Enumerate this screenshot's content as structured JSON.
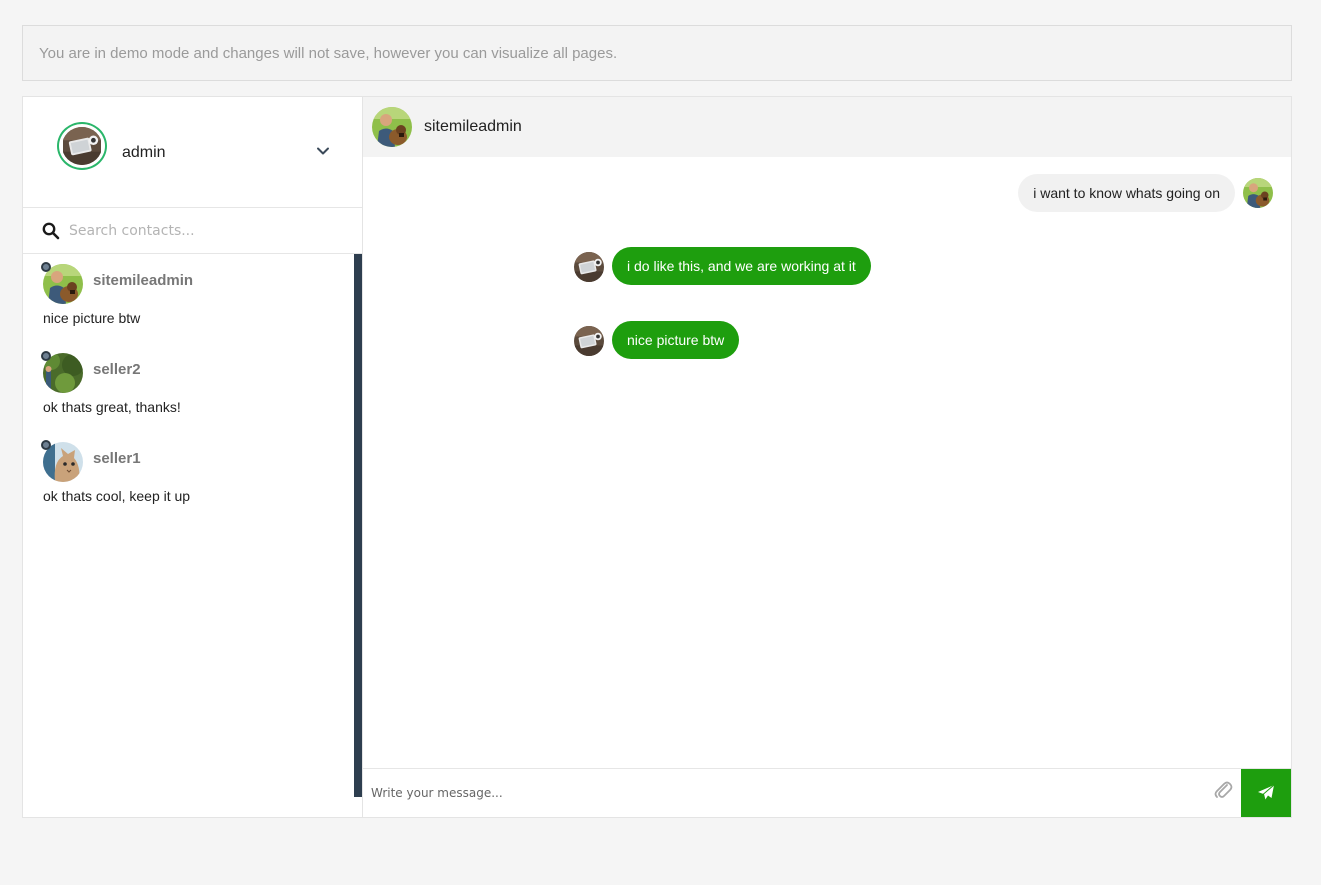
{
  "banner": {
    "text": "You are in demo mode and changes will not save, however you can visualize all pages."
  },
  "current_user": {
    "name": "admin",
    "avatar_icon": "laptop-photo-avatar",
    "dropdown_icon": "chevron-down-icon"
  },
  "search": {
    "placeholder": "Search contacts...",
    "value": ""
  },
  "contacts": [
    {
      "name": "sitemileadmin",
      "preview": "nice picture btw",
      "avatar_icon": "man-with-dog-avatar"
    },
    {
      "name": "seller2",
      "preview": "ok thats great, thanks!",
      "avatar_icon": "garden-avatar"
    },
    {
      "name": "seller1",
      "preview": "ok thats cool, keep it up",
      "avatar_icon": "cat-avatar"
    }
  ],
  "conversation": {
    "title": "sitemileadmin",
    "messages": [
      {
        "direction": "out",
        "text": "i want to know whats going on"
      },
      {
        "direction": "in",
        "text": "i do like this, and we are working at it"
      },
      {
        "direction": "in",
        "text": "nice picture btw"
      }
    ]
  },
  "composer": {
    "placeholder": "Write your message...",
    "value": ""
  },
  "colors": {
    "accent_green": "#1e9e0e",
    "online_ring": "#2ab66a",
    "scrollbar": "#2e3e4f"
  }
}
